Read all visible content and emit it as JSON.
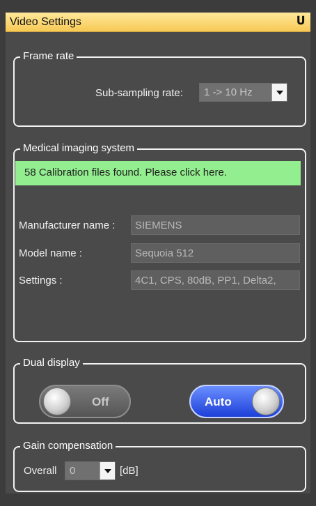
{
  "window": {
    "title": "Video Settings",
    "pin_icon": "pin-icon"
  },
  "frame_rate": {
    "legend": "Frame rate",
    "sub_sampling_label": "Sub-sampling rate:",
    "sub_sampling_value": "1 -> 10 Hz"
  },
  "medical_imaging": {
    "legend": "Medical imaging system",
    "banner": "58 Calibration files found. Please click here.",
    "manufacturer_label": "Manufacturer name :",
    "manufacturer_value": "SIEMENS",
    "model_label": "Model name :",
    "model_value": "Sequoia 512",
    "settings_label": "Settings :",
    "settings_value": "4C1, CPS, 80dB, PP1, Delta2,"
  },
  "dual_display": {
    "legend": "Dual display",
    "off_label": "Off",
    "auto_label": "Auto"
  },
  "gain": {
    "legend": "Gain compensation",
    "overall_label": "Overall",
    "overall_value": "0",
    "unit": "[dB]"
  },
  "colors": {
    "title_bar": "#f7c955",
    "banner": "#92ee8e",
    "auto_toggle": "#1d3fd8"
  }
}
